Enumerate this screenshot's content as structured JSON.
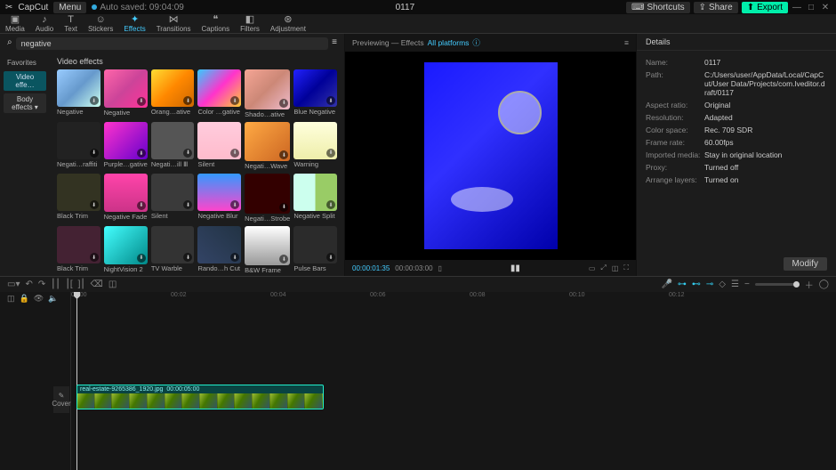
{
  "app": {
    "name": "CapCut",
    "menu": "Menu",
    "autosave": "Auto saved: 09:04:09",
    "title": "0117"
  },
  "topbar": {
    "shortcuts": "Shortcuts",
    "share": "Share",
    "export": "Export"
  },
  "tools": {
    "media": "Media",
    "audio": "Audio",
    "text": "Text",
    "stickers": "Stickers",
    "effects": "Effects",
    "transitions": "Transitions",
    "captions": "Captions",
    "filters": "Filters",
    "adjustment": "Adjustment"
  },
  "search": {
    "value": "negative"
  },
  "sidebar": {
    "favorites": "Favorites",
    "video_effects": "Video effe…",
    "body_effects": "Body effects"
  },
  "effects": {
    "header": "Video effects",
    "items": [
      {
        "label": "Negative",
        "cls": "t-neg1"
      },
      {
        "label": "Negative",
        "cls": "t-neg2"
      },
      {
        "label": "Orang…ative",
        "cls": "t-orang"
      },
      {
        "label": "Color …gative",
        "cls": "t-color"
      },
      {
        "label": "Shado…ative",
        "cls": "t-shadow"
      },
      {
        "label": "Blue Negative",
        "cls": "t-blue"
      },
      {
        "label": "Negati…raffiti",
        "cls": "t-graf"
      },
      {
        "label": "Purple…gative",
        "cls": "t-purp"
      },
      {
        "label": "Negati…ill Ⅲ",
        "cls": "t-blr"
      },
      {
        "label": "Silent",
        "cls": "t-sil"
      },
      {
        "label": "Negati…Wave",
        "cls": "t-wave"
      },
      {
        "label": "Warning",
        "cls": "t-warn"
      },
      {
        "label": "Black Trim",
        "cls": "t-trim"
      },
      {
        "label": "Negative Fade",
        "cls": "t-fade"
      },
      {
        "label": "Silent",
        "cls": "t-sil2"
      },
      {
        "label": "Negative Blur",
        "cls": "t-nblur"
      },
      {
        "label": "Negati…Strobe",
        "cls": "t-strobe"
      },
      {
        "label": "Negative Split",
        "cls": "t-split"
      },
      {
        "label": "Black Trim",
        "cls": "t-trim2"
      },
      {
        "label": "NightVision 2",
        "cls": "t-nvis"
      },
      {
        "label": "TV Warble",
        "cls": "t-tvw"
      },
      {
        "label": "Rando…h Cut",
        "cls": "t-rnd"
      },
      {
        "label": "B&W Frame",
        "cls": "t-bw"
      },
      {
        "label": "Pulse Bars",
        "cls": "t-pulse"
      }
    ]
  },
  "preview": {
    "label": "Previewing — Effects",
    "platform": "All platforms",
    "time_current": "00:00:01:35",
    "time_total": "00:00:03:00"
  },
  "details": {
    "header": "Details",
    "entries": [
      {
        "k": "Name:",
        "v": "0117"
      },
      {
        "k": "Path:",
        "v": "C:/Users/user/AppData/Local/CapCut/User Data/Projects/com.lveditor.draft/0117"
      },
      {
        "k": "Aspect ratio:",
        "v": "Original"
      },
      {
        "k": "Resolution:",
        "v": "Adapted"
      },
      {
        "k": "Color space:",
        "v": "Rec. 709 SDR"
      },
      {
        "k": "Frame rate:",
        "v": "60.00fps"
      },
      {
        "k": "Imported media:",
        "v": "Stay in original location"
      },
      {
        "k": "Proxy:",
        "v": "Turned off"
      },
      {
        "k": "Arrange layers:",
        "v": "Turned on"
      }
    ],
    "modify": "Modify"
  },
  "timeline": {
    "ruler": [
      "00:00",
      "00:02",
      "00:04",
      "00:06",
      "00:08",
      "00:10",
      "00:12"
    ],
    "cover": "Cover",
    "clip_name": "real-estate-9265386_1920.jpg",
    "clip_dur": "00:00:05:00"
  }
}
